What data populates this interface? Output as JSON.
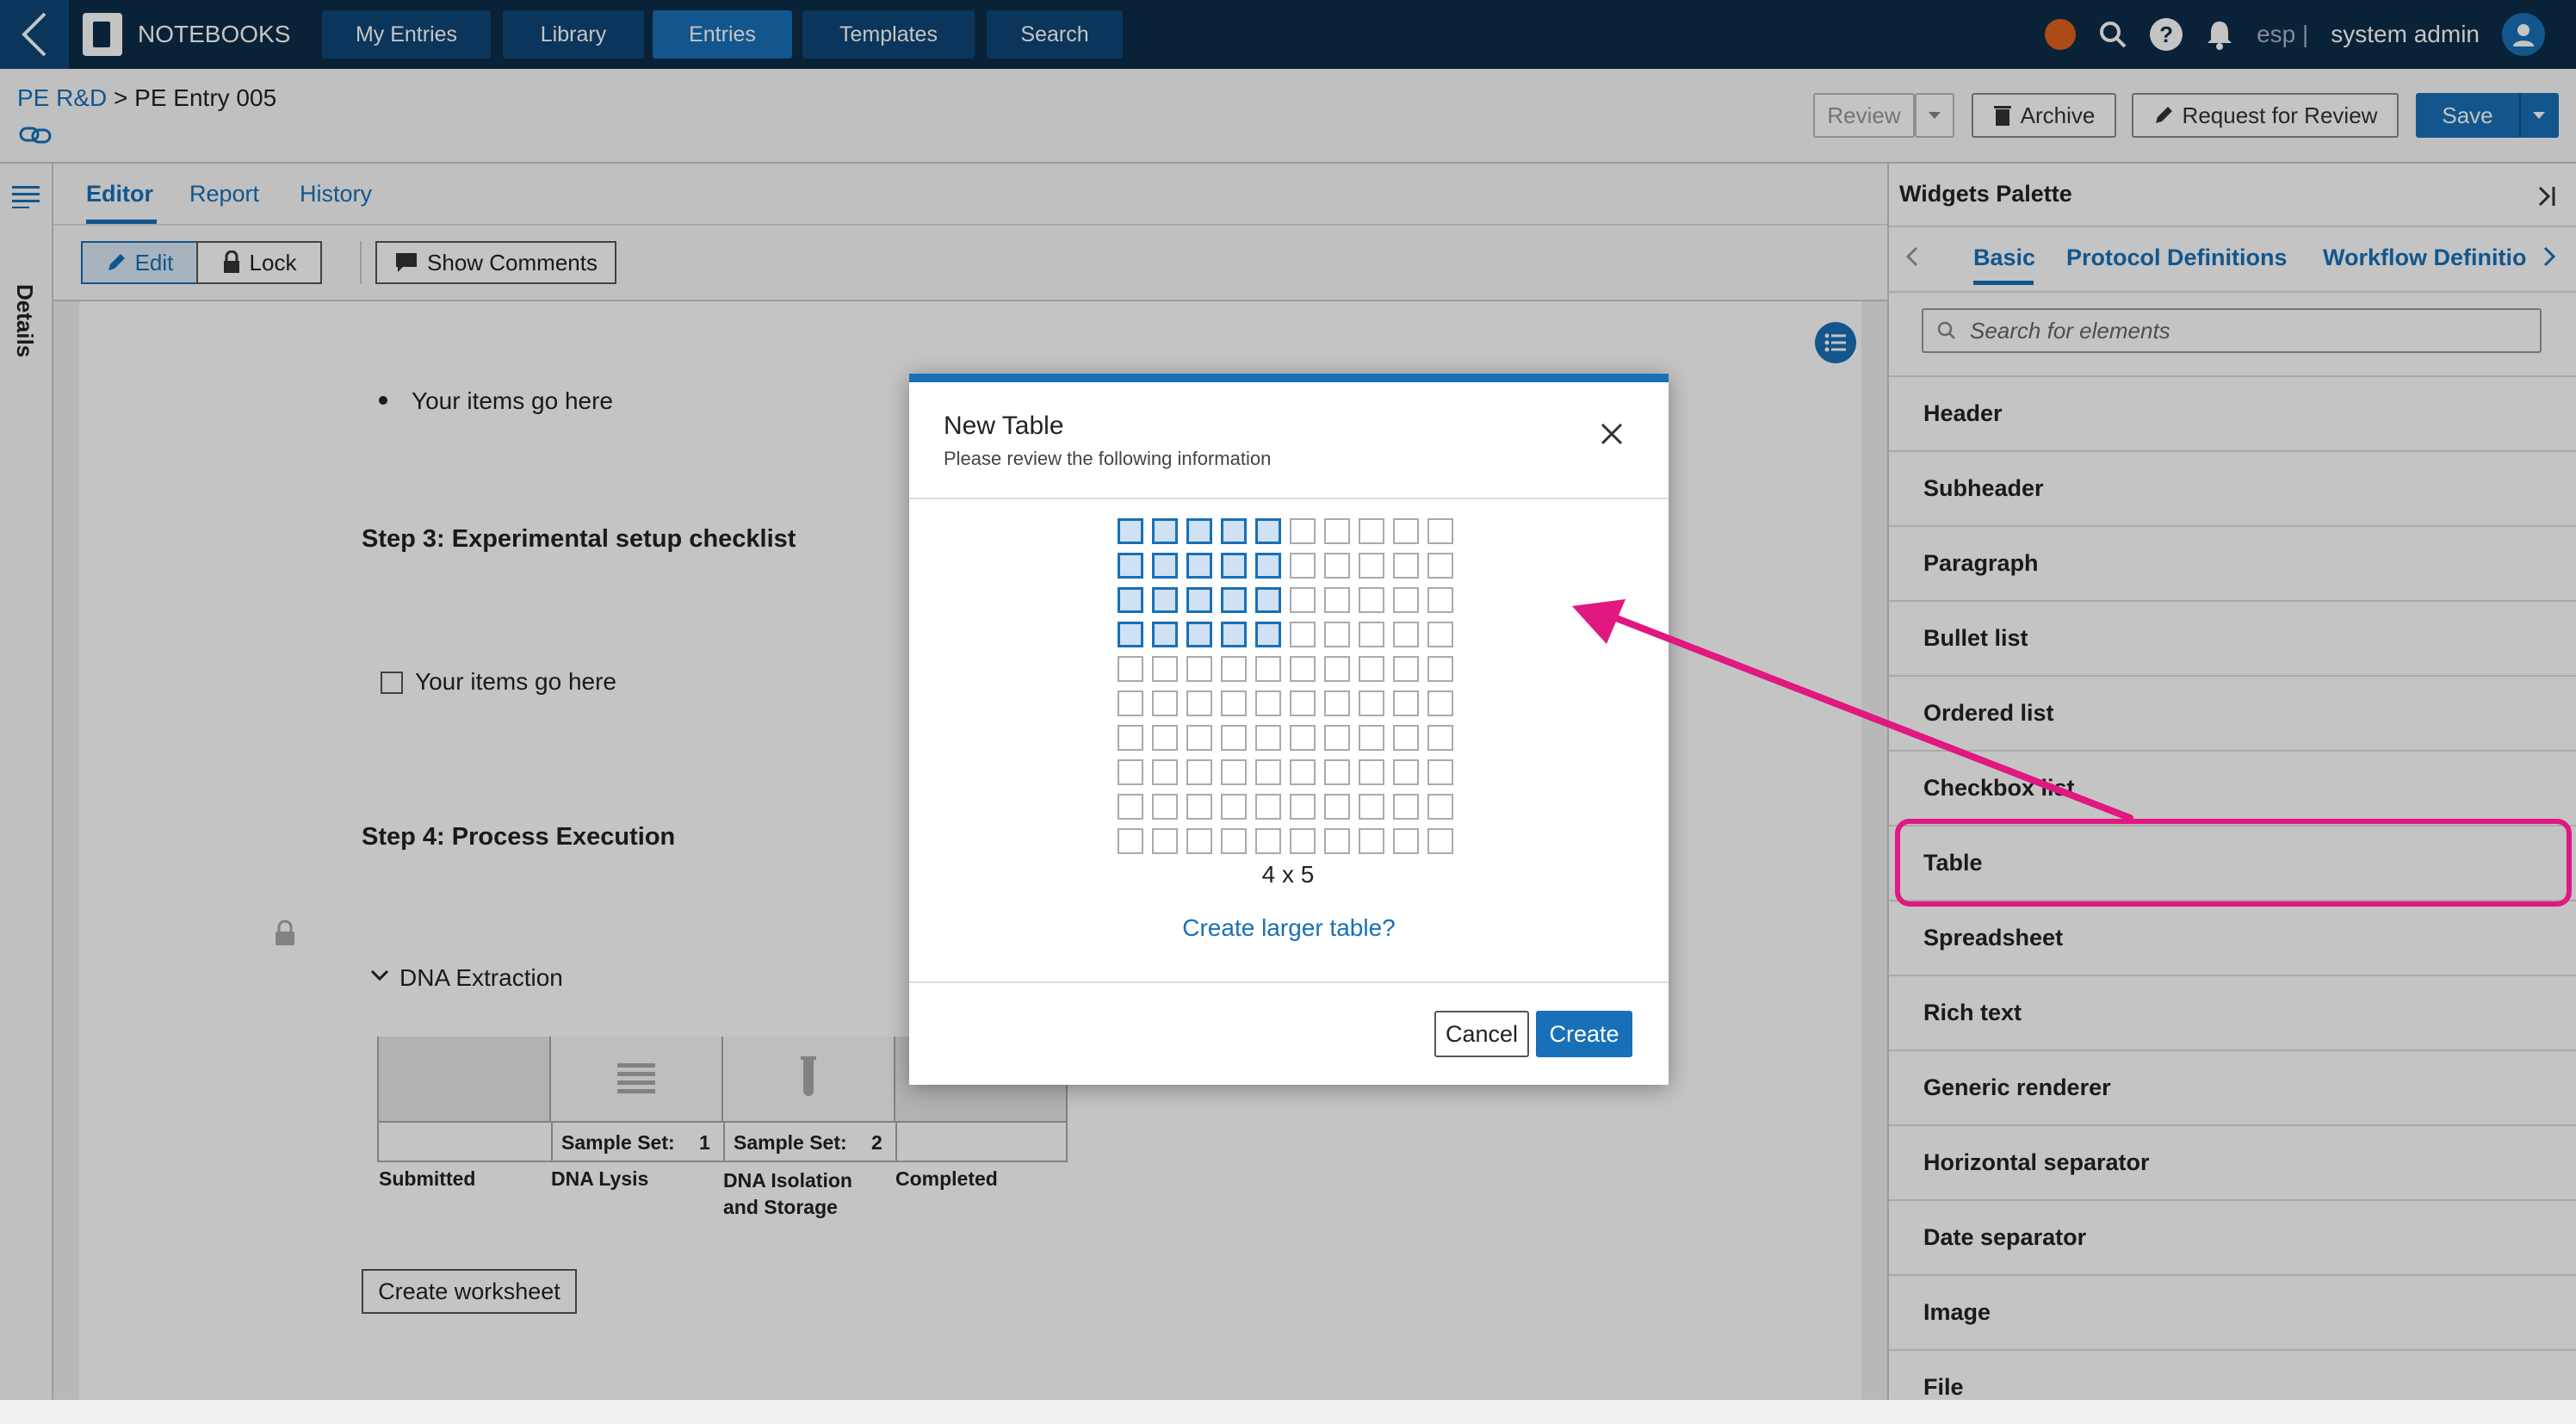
{
  "app": {
    "name": "NOTEBOOKS"
  },
  "nav": {
    "tabs": [
      {
        "label": "My Entries"
      },
      {
        "label": "Library"
      },
      {
        "label": "Entries"
      },
      {
        "label": "Templates"
      },
      {
        "label": "Search"
      }
    ],
    "active": "Entries"
  },
  "user": {
    "org": "esp |",
    "name": "system admin"
  },
  "breadcrumb": {
    "parent": "PE R&D",
    "separator": " > ",
    "current": "PE Entry 005"
  },
  "header_buttons": {
    "review": "Review",
    "archive": "Archive",
    "request_review": "Request for Review",
    "save": "Save"
  },
  "sidebar": {
    "details": "Details"
  },
  "editor": {
    "tabs": [
      {
        "label": "Editor"
      },
      {
        "label": "Report"
      },
      {
        "label": "History"
      }
    ],
    "toolbar": {
      "edit": "Edit",
      "lock": "Lock",
      "show_comments": "Show Comments"
    }
  },
  "canvas": {
    "bullet_item": "Your items go here",
    "step3": "Step 3: Experimental setup checklist",
    "checkbox_item": "Your items go here",
    "step4": "Step 4: Process Execution",
    "section": "DNA Extraction",
    "workflow": {
      "sample_set_label": "Sample Set:",
      "cols": [
        {
          "label": "Submitted",
          "count": ""
        },
        {
          "label": "DNA Lysis",
          "count": "1"
        },
        {
          "label": "DNA Isolation and Storage",
          "count": "2"
        },
        {
          "label": "Completed",
          "count": ""
        }
      ]
    },
    "create_worksheet": "Create worksheet"
  },
  "palette": {
    "title": "Widgets Palette",
    "tabs": [
      {
        "label": "Basic"
      },
      {
        "label": "Protocol Definitions"
      },
      {
        "label": "Workflow Definitio"
      }
    ],
    "search_placeholder": "Search for elements",
    "items": [
      {
        "label": "Header"
      },
      {
        "label": "Subheader"
      },
      {
        "label": "Paragraph"
      },
      {
        "label": "Bullet list"
      },
      {
        "label": "Ordered list"
      },
      {
        "label": "Checkbox list"
      },
      {
        "label": "Table"
      },
      {
        "label": "Spreadsheet"
      },
      {
        "label": "Rich text"
      },
      {
        "label": "Generic renderer"
      },
      {
        "label": "Horizontal separator"
      },
      {
        "label": "Date separator"
      },
      {
        "label": "Image"
      },
      {
        "label": "File"
      }
    ],
    "highlighted": "Table"
  },
  "modal": {
    "title": "New Table",
    "subtitle": "Please review the following information",
    "grid": {
      "rows_total": 10,
      "cols_total": 10,
      "selected_rows": 4,
      "selected_cols": 5
    },
    "dims": "4 x 5",
    "larger_link": "Create larger table?",
    "cancel": "Cancel",
    "create": "Create"
  },
  "colors": {
    "accent": "#1870b8",
    "nav_bg": "#0d2d48",
    "annotation": "#e0187f",
    "status_dot": "#e0621d"
  }
}
